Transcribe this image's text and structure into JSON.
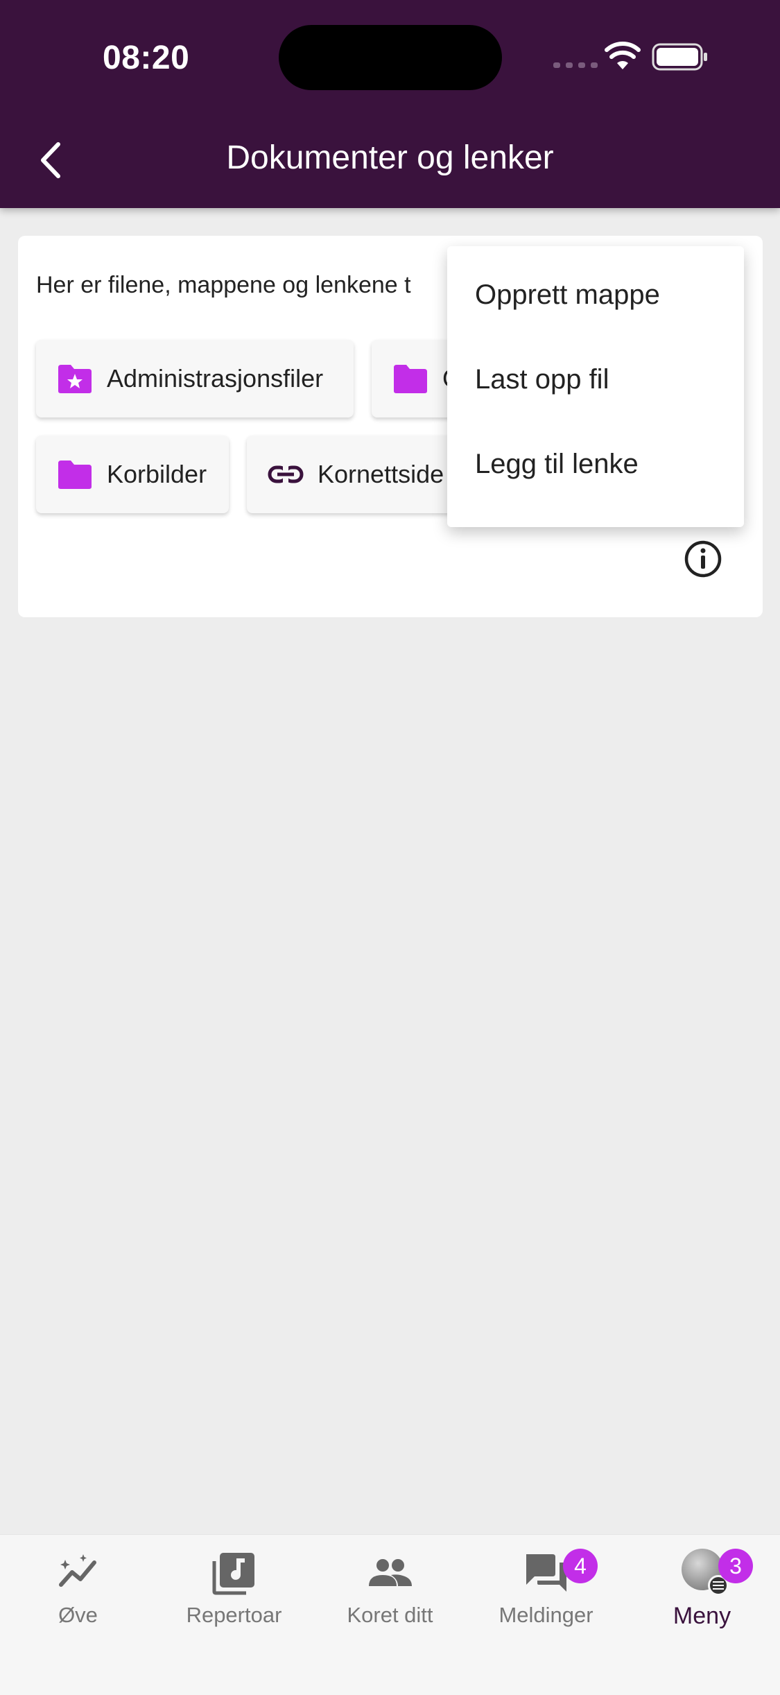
{
  "status_bar": {
    "time": "08:20"
  },
  "header": {
    "title": "Dokumenter og lenker"
  },
  "content": {
    "intro_text": "Her er filene, mappene og lenkene t",
    "chips": [
      {
        "label": "Administrasjonsfiler",
        "icon": "folder-star-icon"
      },
      {
        "label": "C",
        "icon": "folder-icon"
      },
      {
        "label": "Korbilder",
        "icon": "folder-icon"
      },
      {
        "label": "Kornettside",
        "icon": "link-icon"
      }
    ]
  },
  "context_menu": {
    "items": [
      "Opprett mappe",
      "Last opp fil",
      "Legg til lenke"
    ]
  },
  "bottom_nav": {
    "items": [
      {
        "label": "Øve",
        "icon": "practice-icon"
      },
      {
        "label": "Repertoar",
        "icon": "music-library-icon"
      },
      {
        "label": "Koret ditt",
        "icon": "people-icon"
      },
      {
        "label": "Meldinger",
        "icon": "chat-icon",
        "badge": "4"
      },
      {
        "label": "Meny",
        "icon": "avatar-menu-icon",
        "badge": "3"
      }
    ],
    "active": "Meny"
  },
  "colors": {
    "header_bg": "#3a123d",
    "accent": "#c22ee8",
    "background": "#ededed"
  }
}
